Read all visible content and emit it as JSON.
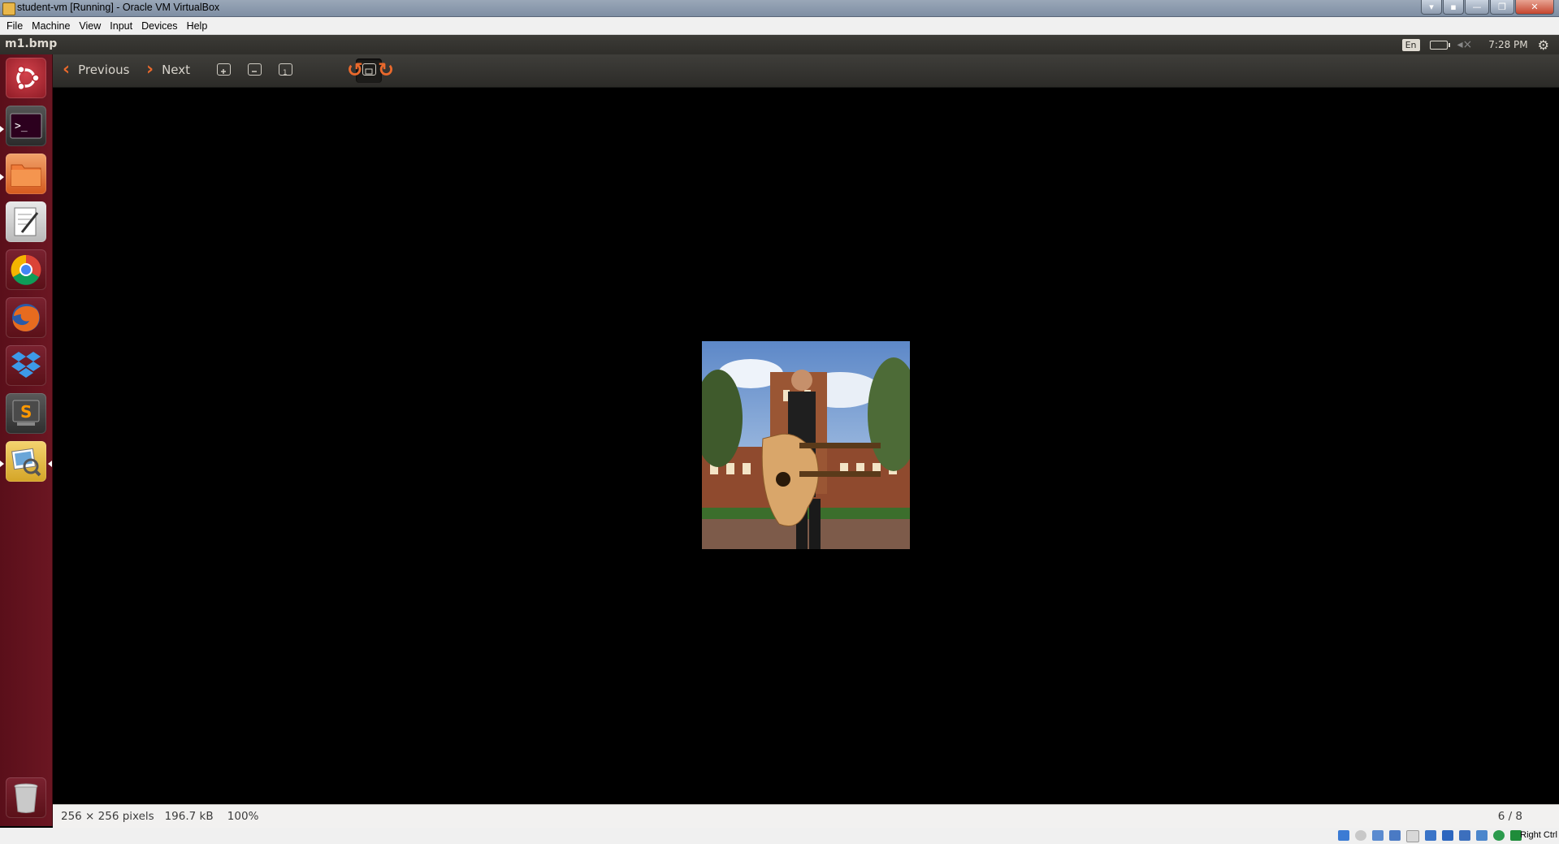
{
  "window": {
    "title": "student-vm [Running] - Oracle VM VirtualBox",
    "controls": [
      "pin",
      "dock",
      "minimize",
      "restore",
      "close"
    ]
  },
  "vbox_menu": [
    "File",
    "Machine",
    "View",
    "Input",
    "Devices",
    "Help"
  ],
  "panel": {
    "app_title": "m1.bmp",
    "keyboard_layout": "En",
    "clock": "7:28 PM"
  },
  "launcher": {
    "items": [
      {
        "name": "dash-home",
        "icon": "ubuntu-logo-icon"
      },
      {
        "name": "terminal",
        "icon": "terminal-icon",
        "running": true
      },
      {
        "name": "files",
        "icon": "folder-icon",
        "running": true
      },
      {
        "name": "text-editor",
        "icon": "text-editor-icon"
      },
      {
        "name": "chrome",
        "icon": "chrome-icon"
      },
      {
        "name": "firefox",
        "icon": "firefox-icon"
      },
      {
        "name": "dropbox",
        "icon": "dropbox-icon"
      },
      {
        "name": "sublime-text",
        "icon": "sublime-text-icon"
      },
      {
        "name": "image-viewer",
        "icon": "image-viewer-icon",
        "running": true,
        "focused": true
      },
      {
        "name": "trash",
        "icon": "trash-icon"
      }
    ]
  },
  "toolbar": {
    "previous_label": "Previous",
    "next_label": "Next",
    "buttons": [
      "zoom-in",
      "zoom-out",
      "normal-size",
      "best-fit",
      "rotate-left",
      "rotate-right"
    ]
  },
  "status": {
    "dimensions": "256 × 256 pixels",
    "filesize": "196.7 kB",
    "zoom": "100%",
    "position": "6 / 8"
  },
  "vbox_status": {
    "host_key": "Right Ctrl"
  },
  "colors": {
    "accent_orange": "#e9692c",
    "launcher_bg": "#5e1220",
    "panel_bg": "#3c3b37"
  }
}
